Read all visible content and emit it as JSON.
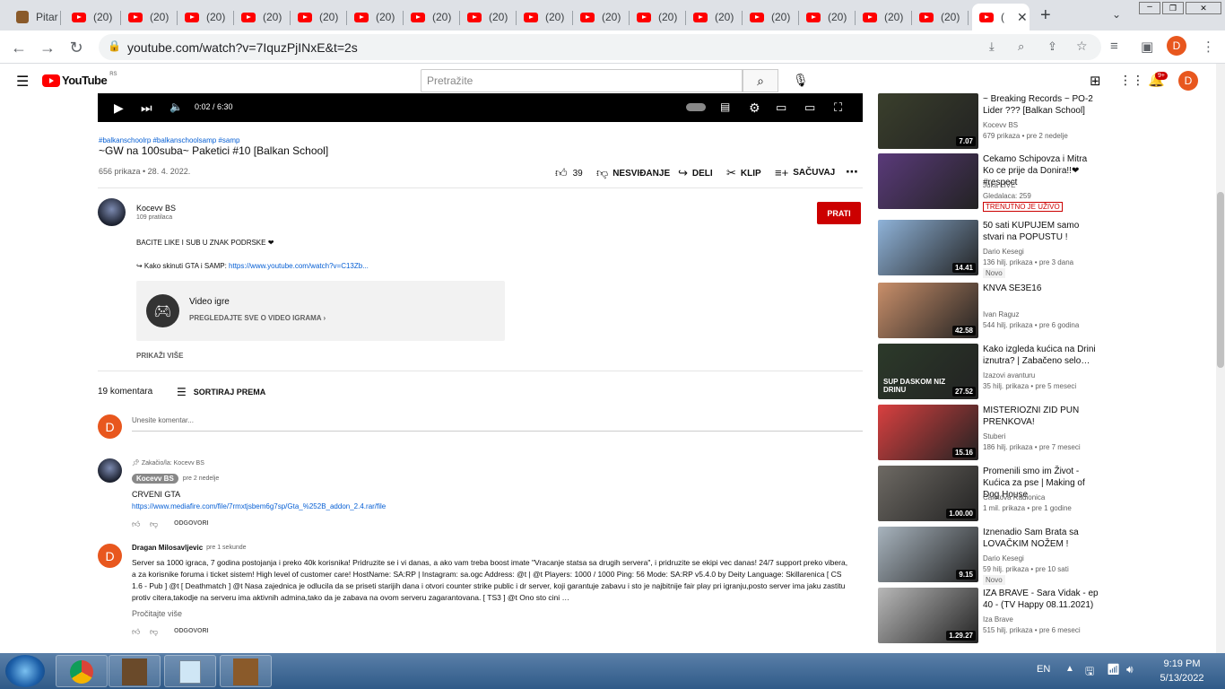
{
  "browser": {
    "first_tab_title": "Pitar",
    "tab_label": "(20)",
    "active_tab_label": "(",
    "url": "youtube.com/watch?v=7IquzPjINxE&t=2s"
  },
  "yt": {
    "logo": "YouTube",
    "logo_region": "RS",
    "search_placeholder": "Pretražite",
    "notif_count": "9+",
    "avatar_letter": "D"
  },
  "player": {
    "time": "0:02 / 6:30"
  },
  "video": {
    "hashtags": "#balkanschoolrp #balkanschoolsamp #samp",
    "title": "~GW na 100suba~ Paketici #10 [Balkan School]",
    "meta": "656 prikaza • 28. 4. 2022.",
    "likes": "39",
    "dislike_label": "NESVIĐANJE",
    "share_label": "DELI",
    "clip_label": "KLIP",
    "save_label": "SAČUVAJ"
  },
  "channel": {
    "name": "Kocevv BS",
    "subs": "109 pratilaca",
    "subscribe_label": "PRATI"
  },
  "description": {
    "line1": "BACITE LIKE I SUB U ZNAK PODRSKE ❤",
    "line2_prefix": "↪ Kako skinuti GTA i SAMP: ",
    "line2_link": "https://www.youtube.com/watch?v=C13Zb...",
    "category_title": "Video igre",
    "category_link": "PREGLEDAJTE SVE O VIDEO IGRAMA",
    "show_more": "PRIKAŽI VIŠE"
  },
  "comments": {
    "count": "19 komentara",
    "sort_label": "SORTIRAJ PREMA",
    "input_placeholder": "Unesite komentar...",
    "items": [
      {
        "pinned": "Zakačio/la: Kocevv BS",
        "author": "Kocevv BS",
        "time": "pre 2 nedelje",
        "text": "CRVENI GTA",
        "link": "https://www.mediafire.com/file/7rmxtjsbem6g7sp/Gta_%252B_addon_2.4.rar/file",
        "reply": "ODGOVORI"
      },
      {
        "author": "Dragan Milosavljevic",
        "time": "pre 1 sekunde",
        "text": "Server sa 1000 igraca, 7 godina postojanja i preko 40k korisnika! Pridruzite se i vi danas, a ako vam treba boost imate \"Vracanje statsa sa drugih servera\", i pridruzite se ekipi vec danas! 24/7 support preko vibera, a za korisnike foruma i ticket sistem! High level of customer care! HostName: SA:RP | Instagram: sa.ogc Address: @t | @t Players: 1000 / 1000 Ping: 56 Mode: SA:RP v5.4.0 by Deity Language: Skillarenica [ CS 1.6 - Pub ] @t [ Deathmatch ] @t Nasa zajednica je odlucila da se priseti starijih dana i otvori counter strike public i dr server, koji garantuje zabavu i sto je najbitnije fair play pri igranju,posto server ima jaku zastitu protiv citera,takodje na serveru ima aktivnih admina,tako da je zabava na ovom serveru zagarantovana. [ TS3 ] @t Ono sto cini …",
        "read_more": "Pročitajte više",
        "reply": "ODGOVORI"
      }
    ]
  },
  "sidebar": [
    {
      "title": "~ Breaking Records ~ PO-2 Lider ??? [Balkan School]",
      "channel": "Kocevv BS",
      "meta": "679 prikaza • pre 2 nedelje",
      "duration": "7.07",
      "thumb_color": "#3a3f2c"
    },
    {
      "title": "Cekamo Schipovza i Mitra Ko ce prije da Donira!!❤ #respect",
      "channel": "Juka LIVE",
      "meta": "Gledalaca: 259",
      "live": "TRENUTNO JE UŽIVO",
      "thumb_color": "#5a3a7a"
    },
    {
      "title": "50 sati KUPUJEM samo stvari na POPUSTU !",
      "channel": "Dario Kesegi",
      "meta": "136 hilj. prikaza • pre 3 dana",
      "duration": "14.41",
      "new": "Novo",
      "thumb_color": "#8fb3d9"
    },
    {
      "title": "KNVA SE3E16",
      "channel": "Ivan Raguz",
      "meta": "544 hilj. prikaza • pre 6 godina",
      "duration": "42.58",
      "thumb_color": "#c98f6a"
    },
    {
      "title": "Kako izgleda kućica na Drini iznutra? | Zabačeno selo…",
      "channel": "Izazovi avanturu",
      "meta": "35 hilj. prikaza • pre 5 meseci",
      "duration": "27.52",
      "thumb_overlay": "SUP DASKOM NIZ DRINU",
      "thumb_color": "#2c3a2a"
    },
    {
      "title": "MISTERIOZNI ZID PUN PRENKOVA!",
      "channel": "Stuberi",
      "meta": "186 hilj. prikaza • pre 7 meseci",
      "duration": "15.16",
      "thumb_color": "#d94040"
    },
    {
      "title": "Promenili smo im Život - Kućica za pse | Making of Dog House",
      "channel": "Čaletova Radionica",
      "meta": "1 mil. prikaza • pre 1 godine",
      "duration": "1.00.00",
      "thumb_color": "#6e6a64"
    },
    {
      "title": "Iznenadio Sam Brata sa LOVAČKIM NOŽEM !",
      "channel": "Dario Kesegi",
      "meta": "59 hilj. prikaza • pre 10 sati",
      "duration": "9.15",
      "new": "Novo",
      "thumb_color": "#a8b4be"
    },
    {
      "title": "IZA BRAVE - Sara Vidak - ep 40 - (TV Happy 08.11.2021)",
      "channel": "Iza Brave",
      "meta": "515 hilj. prikaza • pre 6 meseci",
      "duration": "1.29.27",
      "thumb_color": "#b8b8b8"
    }
  ],
  "taskbar": {
    "lang": "EN",
    "time": "9:19 PM",
    "date": "5/13/2022"
  }
}
